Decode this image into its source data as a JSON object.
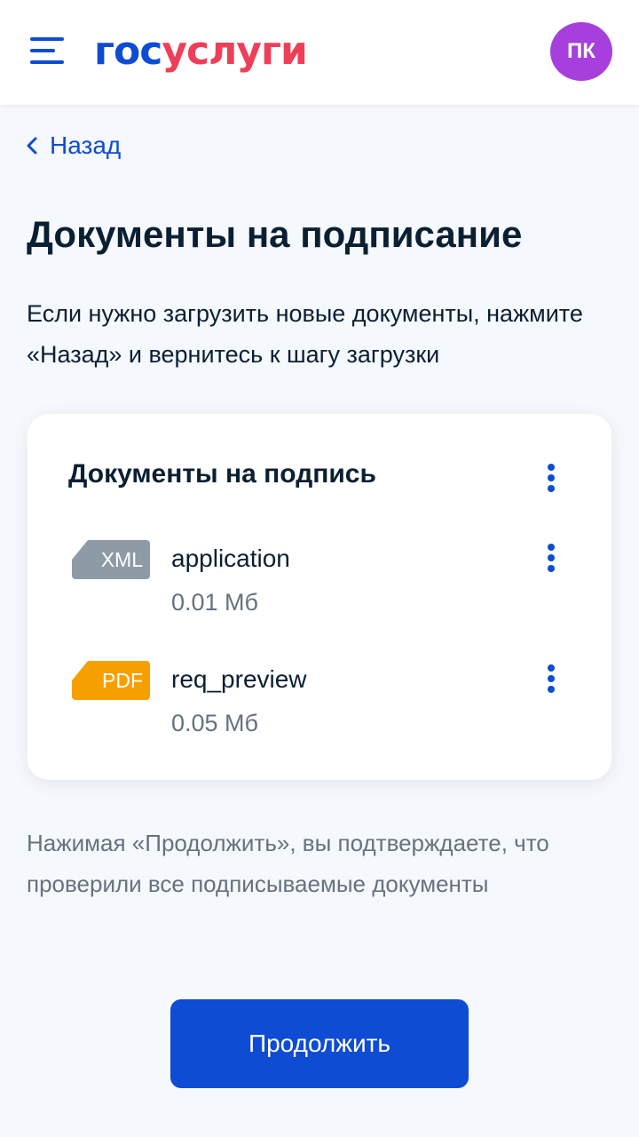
{
  "header": {
    "logo_part1": "гос",
    "logo_part2": "услуги",
    "avatar_initials": "ПК"
  },
  "nav": {
    "back_label": "Назад"
  },
  "page": {
    "title": "Документы на подписание",
    "description": "Если нужно загрузить новые документы, нажмите «Назад» и вернитесь к шагу загрузки"
  },
  "card": {
    "title": "Документы на подпись",
    "documents": [
      {
        "type": "XML",
        "name": "application",
        "size": "0.01 Мб"
      },
      {
        "type": "PDF",
        "name": "req_preview",
        "size": "0.05 Мб"
      }
    ]
  },
  "note": "Нажимая «Продолжить», вы подтверждаете, что проверили все подписываемые документы",
  "actions": {
    "continue_label": "Продолжить"
  },
  "colors": {
    "primary": "#0d4cd3",
    "brand_red": "#ee3f58",
    "avatar_bg": "#a63fdc",
    "xml_badge": "#8e9aa6",
    "pdf_badge": "#f6a000"
  },
  "icons": {
    "menu": "hamburger-menu-icon",
    "back": "chevron-left-icon",
    "more": "kebab-menu-icon"
  }
}
